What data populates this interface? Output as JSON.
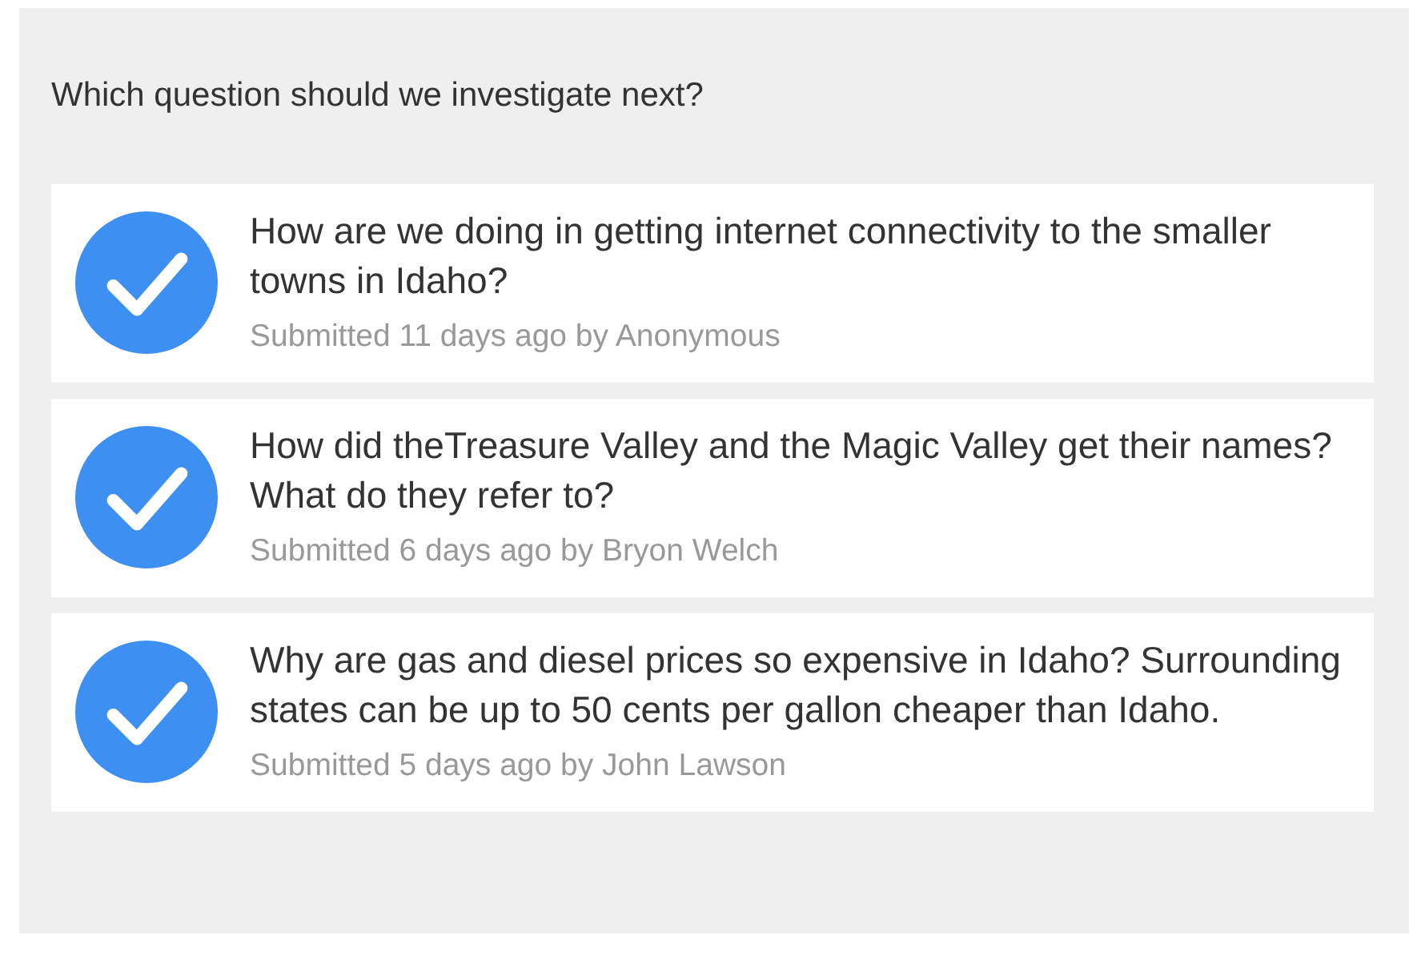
{
  "heading": "Which question should we investigate next?",
  "questions": [
    {
      "text": "How are we doing in getting internet connectivity to the smaller towns in Idaho?",
      "meta": "Submitted 11 days ago by Anonymous",
      "checked": true
    },
    {
      "text": "How did theTreasure Valley and the Magic Valley get their names? What do they refer to?",
      "meta": "Submitted 6 days ago by Bryon Welch",
      "checked": true
    },
    {
      "text": "Why are gas and diesel prices so expensive in Idaho? Surrounding states can be up to 50 cents per gallon cheaper than Idaho.",
      "meta": "Submitted 5 days ago by John Lawson",
      "checked": true
    }
  ]
}
